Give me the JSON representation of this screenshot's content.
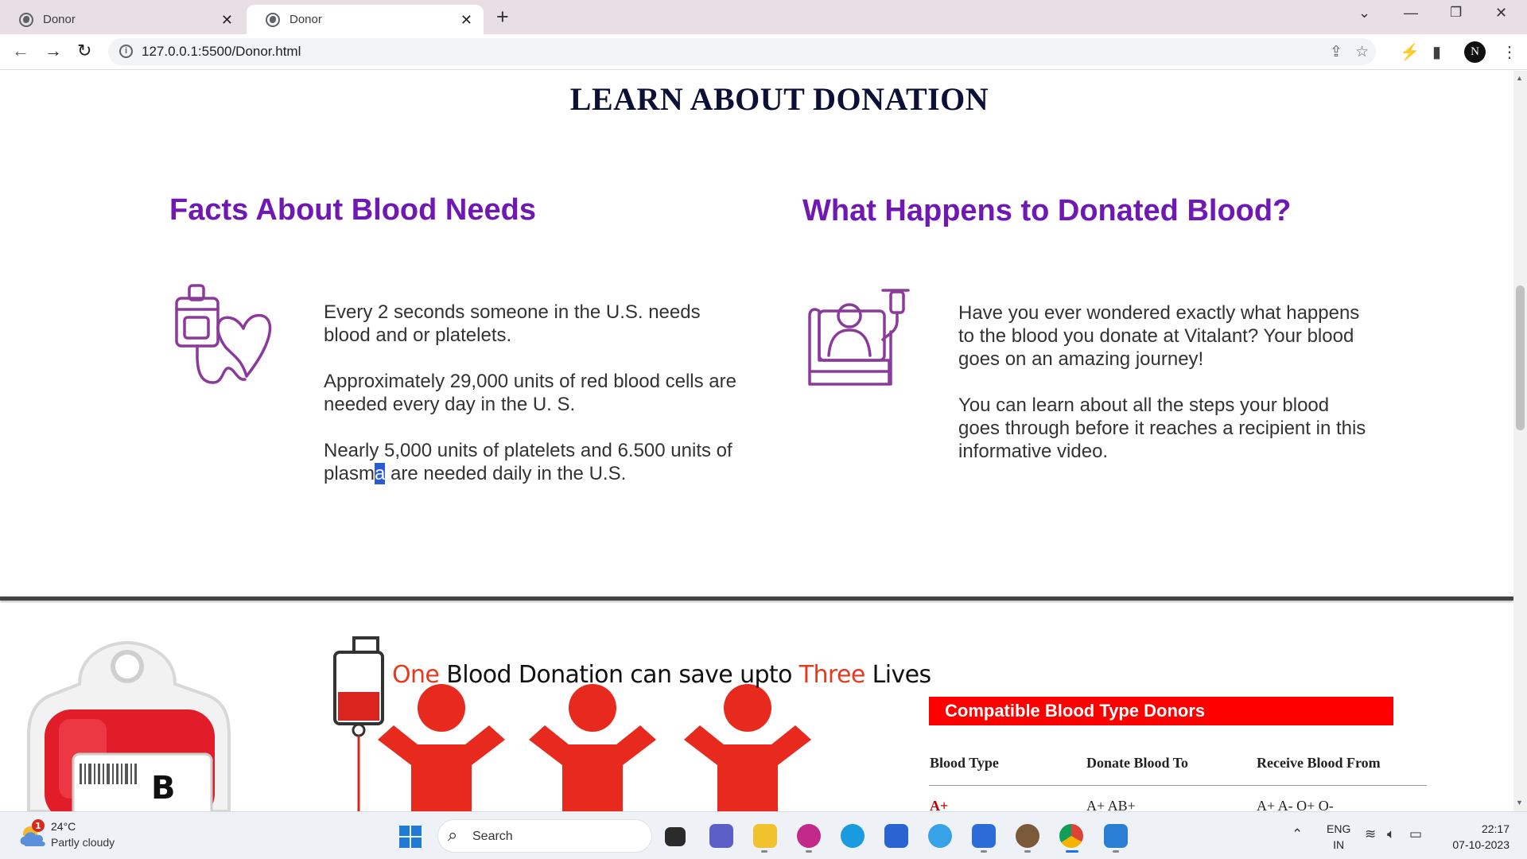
{
  "browser": {
    "tabs": [
      {
        "title": "Donor",
        "active": false
      },
      {
        "title": "Donor",
        "active": true
      }
    ],
    "url": "127.0.0.1:5500/Donor.html",
    "profile_initial": "N"
  },
  "page": {
    "heading": "LEARN ABOUT DONATION",
    "facts": {
      "title": "Facts About Blood Needs",
      "p1": "Every 2 seconds someone in the U.S. needs blood and or platelets.",
      "p2": "Approximately 29,000 units of red blood cells are needed every day in the U. S.",
      "p3_before": "Nearly 5,000 units of platelets and 6.500 units of plasm",
      "p3_selected": "a",
      "p3_after": " are needed daily in the U.S."
    },
    "happens": {
      "title": "What Happens to Donated Blood?",
      "p1": "Have you ever wondered exactly what happens to the blood you donate at Vitalant? Your blood goes on an amazing journey!",
      "p2": "You can learn about all the steps your blood goes through before it reaches a recipient in this informative video."
    },
    "bag_label": "B",
    "lives_caption": {
      "one": "One",
      "mid": " Blood Donation can save upto ",
      "three": "Three",
      "end": " Lives"
    },
    "compat": {
      "title": "Compatible Blood Type Donors",
      "headers": [
        "Blood Type",
        "Donate Blood To",
        "Receive Blood From"
      ],
      "rows": [
        {
          "type": "A+",
          "donate_to": "A+ AB+",
          "receive_from": "A+ A- O+ O-"
        }
      ]
    }
  },
  "taskbar": {
    "weather_temp": "24°C",
    "weather_desc": "Partly cloudy",
    "weather_badge": "1",
    "search": "Search",
    "lang_1": "ENG",
    "lang_2": "IN",
    "time": "22:17",
    "date": "07-10-2023"
  },
  "colors": {
    "accent_purple": "#7018b4",
    "heading_navy": "#0c1035",
    "compat_red": "#ff0000",
    "highlight_orange": "#e33b1f"
  }
}
